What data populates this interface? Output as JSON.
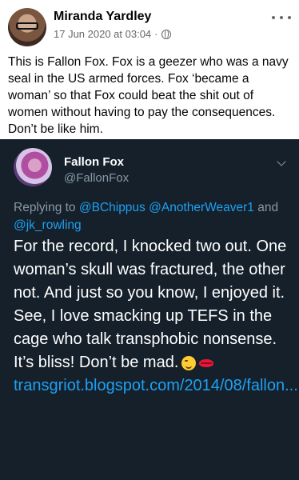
{
  "post": {
    "author": "Miranda Yardley",
    "timestamp": "17 Jun 2020 at 03:04",
    "separator": "·",
    "text": "This is Fallon Fox. Fox is a geezer who was a navy seal in the US armed forces. Fox ‘became a woman’ so that Fox could beat the shit out of women without having to pay the consequences. Don’t be like him."
  },
  "tweet": {
    "name": "Fallon Fox",
    "handle": "@FallonFox",
    "replying_prefix": "Replying to",
    "replying_to": [
      "@BChippus",
      "@AnotherWeaver1"
    ],
    "replying_and": "and",
    "replying_last": "@jk_rowling",
    "body": "For the record, I knocked two out. One woman’s skull was fractured, the other not. And just so you know, I enjoyed it. See, I love smacking up TEFS in the cage who talk transphobic nonsense. It’s bliss! Don’t be mad.",
    "emojis": [
      "winking-face",
      "kiss-mark"
    ],
    "link_text": "transgriot.blogspot.com/2014/08/fallon..."
  },
  "colors": {
    "tweet_bg": "#15202b",
    "mention": "#1da1f2",
    "muted": "#8899a6"
  }
}
